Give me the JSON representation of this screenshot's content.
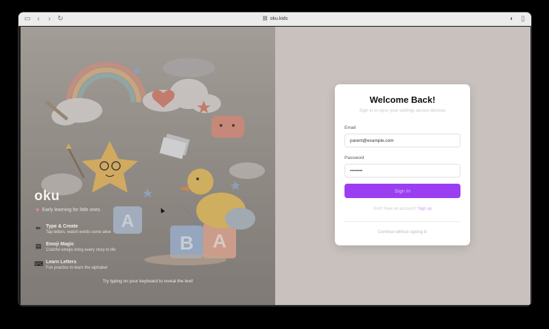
{
  "browser": {
    "url": "oku.kids",
    "icons": [
      "sidebar-icon",
      "back-icon",
      "forward-icon",
      "reload-icon",
      "link-icon",
      "extension-icon",
      "split-view-icon"
    ]
  },
  "left_panel": {
    "brand": "oku",
    "tagline": "Early learning for little ones",
    "features": [
      {
        "icon": "pencil-icon",
        "title": "Type & Create",
        "desc": "Tap letters, watch words come alive"
      },
      {
        "icon": "book-icon",
        "title": "Emoji Magic",
        "desc": "Colorful emojis bring every story to life"
      },
      {
        "icon": "keyboard-icon",
        "title": "Learn Letters",
        "desc": "Fun practice to learn the alphabet"
      }
    ],
    "hint": "Try typing on your keyboard to reveal the text!"
  },
  "login": {
    "title": "Welcome Back!",
    "subtitle": "Sign in to sync your settings across devices",
    "email_label": "Email",
    "email_value": "parent@example.com",
    "password_label": "Password",
    "password_value": "••••••••",
    "signin_label": "Sign In",
    "no_account": "Don't have an account?",
    "signup_label": "Sign up",
    "guest_label": "Continue without signing in"
  },
  "colors": {
    "accent": "#9b3df0",
    "right_bg": "#c8c1be",
    "card_bg": "#ffffff"
  }
}
